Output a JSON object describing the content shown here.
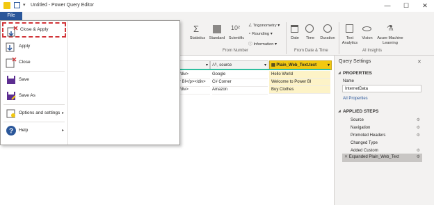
{
  "window": {
    "title": "Untitled - Power Query Editor",
    "minimize": "—",
    "maximize": "☐",
    "close": "✕"
  },
  "ribbon": {
    "file_tab": "File",
    "number_group": {
      "label": "From Number",
      "statistics": "Statistics",
      "standard": "Standard",
      "scientific": "Scientific",
      "trigonometry": "Trigonometry",
      "rounding": "Rounding",
      "information": "Information"
    },
    "datetime_group": {
      "label": "From Date & Time",
      "date": "Date",
      "time": "Time",
      "duration": "Duration"
    },
    "ai_group": {
      "label": "AI Insights",
      "text_analytics_1": "Text",
      "text_analytics_2": "Analytics",
      "vision": "Vision",
      "azure_ml_1": "Azure Machine",
      "azure_ml_2": "Learning"
    }
  },
  "file_menu": {
    "items": [
      {
        "label": "Close & Apply"
      },
      {
        "label": "Apply"
      },
      {
        "label": "Close"
      },
      {
        "label": "Save"
      },
      {
        "label": "Save As"
      },
      {
        "label": "Options and settings"
      },
      {
        "label": "Help"
      }
    ]
  },
  "grid": {
    "columns": [
      "",
      "source",
      "Plain_Web_Text.text"
    ],
    "rows": [
      [
        "/div>",
        "Google",
        "Hello World"
      ],
      [
        "r BI</p></div>",
        "C# Corner",
        "Welcome to Power BI"
      ],
      [
        "/div>",
        "Amazon",
        "Buy Clothes"
      ]
    ]
  },
  "query_settings": {
    "title": "Query Settings",
    "close": "✕",
    "properties_heading": "PROPERTIES",
    "name_label": "Name",
    "name_value": "InternetData",
    "all_properties": "All Properties",
    "applied_steps_heading": "APPLIED STEPS",
    "steps": [
      "Source",
      "Navigation",
      "Promoted Headers",
      "Changed Type",
      "Added Custom",
      "Expanded Plain_Web_Text"
    ]
  }
}
